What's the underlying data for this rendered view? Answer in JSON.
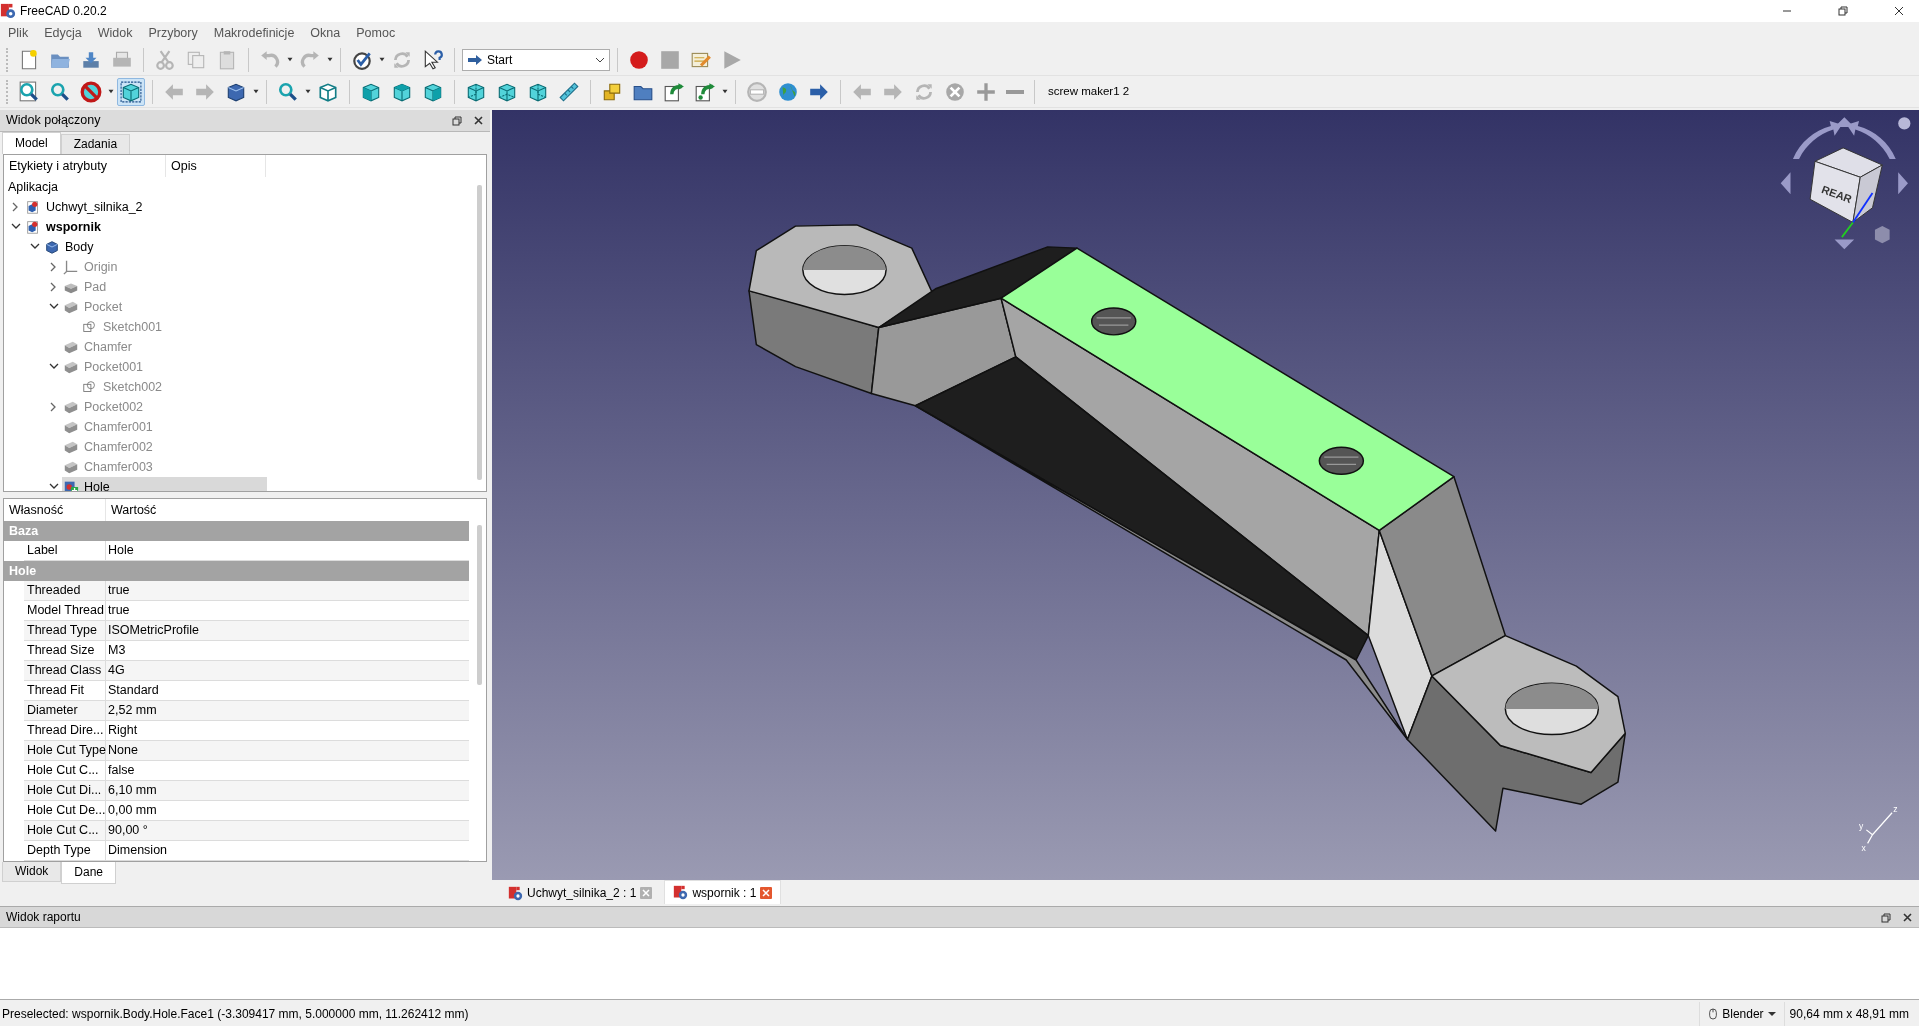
{
  "window": {
    "title": "FreeCAD 0.20.2"
  },
  "menu": [
    "Plik",
    "Edycja",
    "Widok",
    "Przybory",
    "Makrodefinicje",
    "Okna",
    "Pomoc"
  ],
  "toolbar": {
    "workbench": "Start",
    "macro_label": "screw maker1 2"
  },
  "combo_view": {
    "title": "Widok połączony",
    "tabs": [
      {
        "label": "Model",
        "selected": true
      },
      {
        "label": "Zadania",
        "selected": false
      }
    ],
    "tree": {
      "columns": [
        "Etykiety i atrybuty",
        "Opis"
      ],
      "root": "Aplikacja",
      "items": [
        {
          "label": "Uchwyt_silnika_2",
          "kind": "document",
          "expanded": false,
          "active": false,
          "selected": false
        },
        {
          "label": "wspornik",
          "kind": "document",
          "expanded": true,
          "active": true,
          "selected": false,
          "children": [
            {
              "label": "Body",
              "kind": "body",
              "expanded": true,
              "visible": true,
              "selected": false,
              "children": [
                {
                  "label": "Origin",
                  "kind": "origin",
                  "expanded": false,
                  "visible": false,
                  "selected": false
                },
                {
                  "label": "Pad",
                  "kind": "pad",
                  "expanded": false,
                  "visible": false,
                  "selected": false
                },
                {
                  "label": "Pocket",
                  "kind": "feature",
                  "expanded": true,
                  "visible": false,
                  "selected": false,
                  "children": [
                    {
                      "label": "Sketch001",
                      "kind": "sketch",
                      "visible": false,
                      "selected": false
                    }
                  ]
                },
                {
                  "label": "Chamfer",
                  "kind": "feature",
                  "visible": false,
                  "selected": false
                },
                {
                  "label": "Pocket001",
                  "kind": "feature",
                  "expanded": true,
                  "visible": false,
                  "selected": false,
                  "children": [
                    {
                      "label": "Sketch002",
                      "kind": "sketch",
                      "visible": false,
                      "selected": false
                    }
                  ]
                },
                {
                  "label": "Pocket002",
                  "kind": "feature",
                  "expanded": false,
                  "visible": false,
                  "selected": false
                },
                {
                  "label": "Chamfer001",
                  "kind": "feature",
                  "visible": false,
                  "selected": false
                },
                {
                  "label": "Chamfer002",
                  "kind": "feature",
                  "visible": false,
                  "selected": false
                },
                {
                  "label": "Chamfer003",
                  "kind": "feature",
                  "visible": false,
                  "selected": false
                },
                {
                  "label": "Hole",
                  "kind": "hole",
                  "expanded": true,
                  "visible": true,
                  "selected": true
                }
              ]
            }
          ]
        }
      ]
    },
    "properties": {
      "columns": [
        "Własność",
        "Wartość"
      ],
      "groups": [
        {
          "name": "Baza",
          "rows": [
            {
              "property": "Label",
              "value": "Hole"
            }
          ]
        },
        {
          "name": "Hole",
          "rows": [
            {
              "property": "Threaded",
              "value": "true"
            },
            {
              "property": "Model Thread",
              "value": "true"
            },
            {
              "property": "Thread Type",
              "value": "ISOMetricProfile"
            },
            {
              "property": "Thread Size",
              "value": "M3"
            },
            {
              "property": "Thread Class",
              "value": "4G"
            },
            {
              "property": "Thread Fit",
              "value": "Standard"
            },
            {
              "property": "Diameter",
              "value": "2,52 mm"
            },
            {
              "property": "Thread Dire...",
              "value": "Right"
            },
            {
              "property": "Hole Cut Type",
              "value": "None"
            },
            {
              "property": "Hole Cut C...",
              "value": "false"
            },
            {
              "property": "Hole Cut Di...",
              "value": "6,10 mm"
            },
            {
              "property": "Hole Cut De...",
              "value": "0,00 mm"
            },
            {
              "property": "Hole Cut C...",
              "value": "90,00 °"
            },
            {
              "property": "Depth Type",
              "value": "Dimension"
            }
          ]
        }
      ]
    },
    "bottom_tabs": [
      {
        "label": "Widok",
        "selected": false
      },
      {
        "label": "Dane",
        "selected": true
      }
    ]
  },
  "viewport": {
    "navigation_cube": {
      "face_label": "REAR"
    },
    "axis_labels": [
      "z",
      "y",
      "x"
    ]
  },
  "document_tabs": [
    {
      "label": "Uchwyt_silnika_2 : 1",
      "selected": false
    },
    {
      "label": "wspornik : 1",
      "selected": true
    }
  ],
  "report_view": {
    "title": "Widok raportu"
  },
  "status_bar": {
    "message": "Preselected: wspornik.Body.Hole.Face1 (-3.309417 mm, 5.000000 mm, 11.262412 mm)",
    "navigation_style": "Blender",
    "dimensions": "90,64 mm x 48,91 mm"
  }
}
